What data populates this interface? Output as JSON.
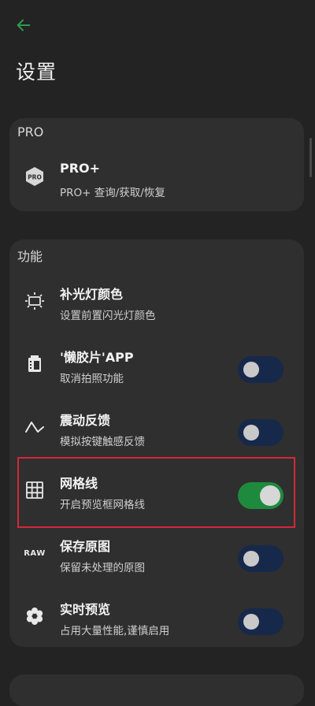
{
  "header": {
    "title": "设置",
    "back_icon": "arrow-left-icon",
    "accent_color": "#2e9a4e"
  },
  "pro_section": {
    "title": "PRO",
    "item": {
      "label": "PRO+",
      "description": "PRO+ 查询/获取/恢复",
      "icon": "pro-hexagon-icon",
      "icon_text": "PRO"
    }
  },
  "func_section": {
    "title": "功能",
    "items": [
      {
        "label": "补光灯颜色",
        "description": "设置前置闪光灯颜色",
        "icon": "fill-light-icon",
        "toggle": null
      },
      {
        "label": "'懒胶片'APP",
        "description": "取消拍照功能",
        "icon": "film-icon",
        "toggle": false
      },
      {
        "label": "震动反馈",
        "description": "模拟按键触感反馈",
        "icon": "vibration-wave-icon",
        "toggle": false
      },
      {
        "label": "网格线",
        "description": "开启预览框网格线",
        "icon": "grid-icon",
        "toggle": true
      },
      {
        "label": "保存原图",
        "description": "保留未处理的原图",
        "icon": "raw-icon",
        "icon_text": "RAW",
        "toggle": false
      },
      {
        "label": "实时预览",
        "description": "占用大量性能,谨慎启用",
        "icon": "settings-flower-icon",
        "toggle": false
      }
    ]
  },
  "colors": {
    "background": "#232323",
    "card": "#2f2f2f",
    "toggle_off": "#17294a",
    "toggle_on": "#1e8a3e",
    "highlight": "#d3283a"
  }
}
